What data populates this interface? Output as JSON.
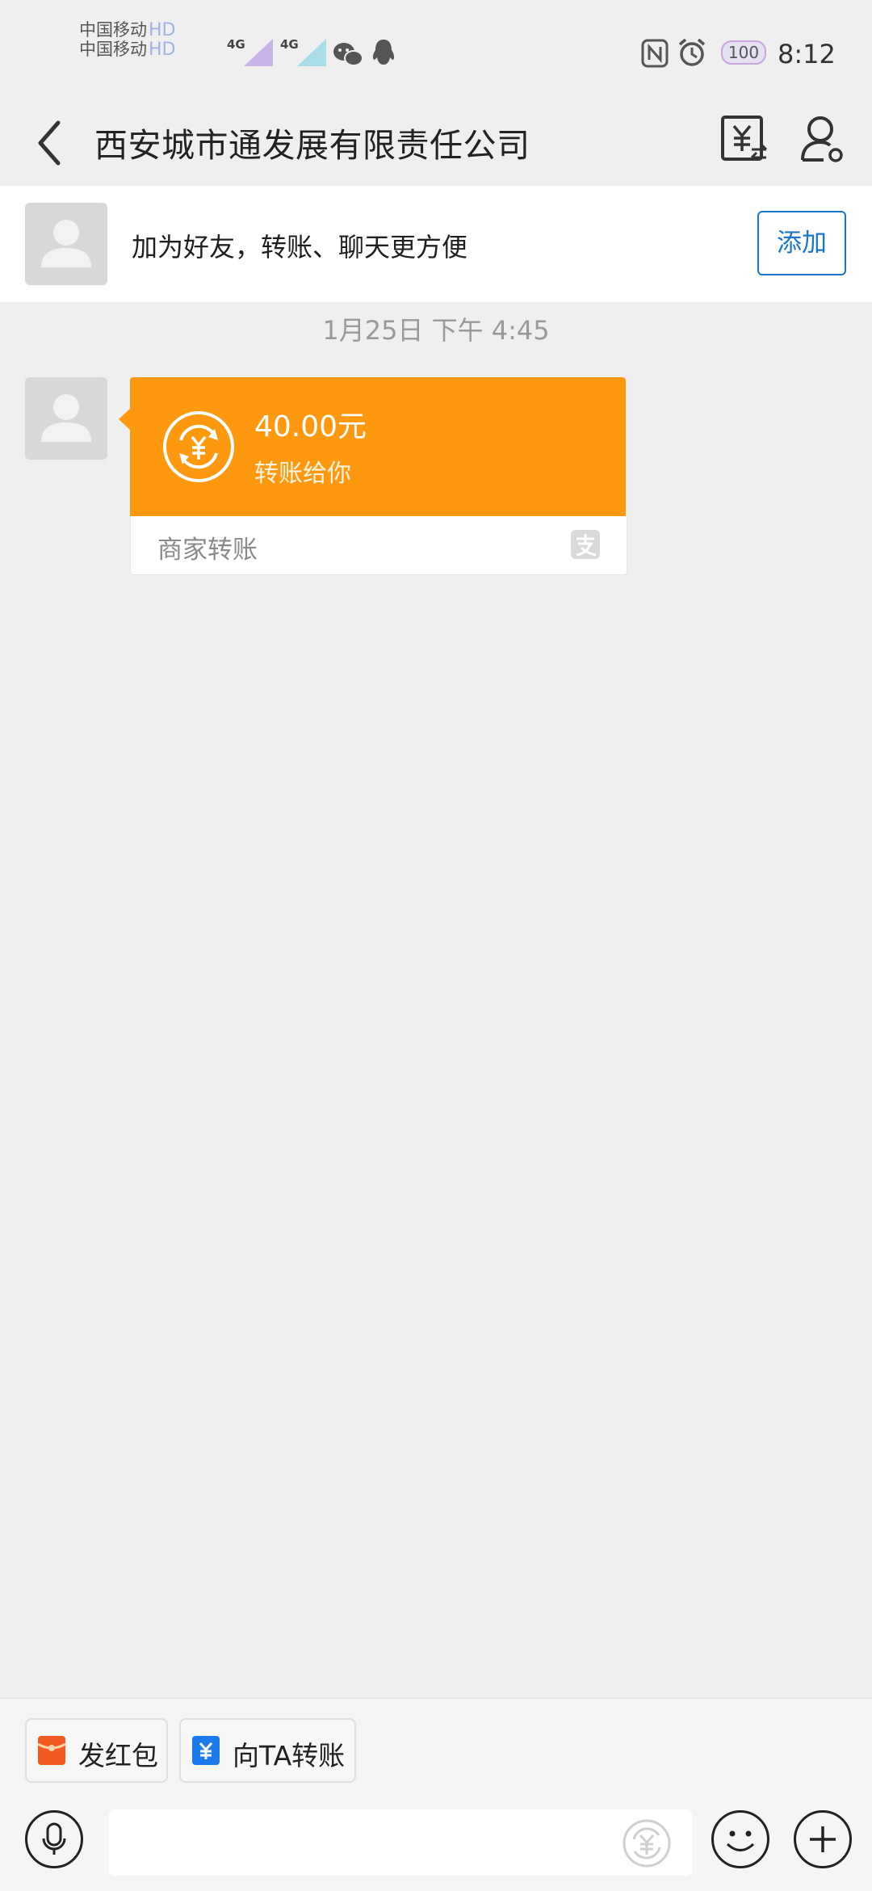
{
  "status_bar": {
    "carrier_1": "中国移动",
    "carrier_1_suffix": "HD",
    "carrier_2": "中国移动",
    "carrier_2_suffix": "HD",
    "network_1": "4G",
    "network_2": "4G",
    "battery": "100",
    "time": "8:12"
  },
  "header": {
    "title": "西安城市通发展有限责任公司"
  },
  "banner": {
    "text": "加为好友，转账、聊天更方便",
    "add_label": "添加"
  },
  "chat": {
    "timestamp": "1月25日 下午 4:45",
    "transfer_card": {
      "amount": "40.00元",
      "subtitle": "转账给你",
      "source": "商家转账"
    }
  },
  "quick_actions": [
    {
      "label": "发红包",
      "color": "#f25a22"
    },
    {
      "label": "向TA转账",
      "color": "#1b7bea"
    }
  ],
  "colors": {
    "accent_orange": "#fe980f",
    "link_blue": "#1b76c9"
  }
}
